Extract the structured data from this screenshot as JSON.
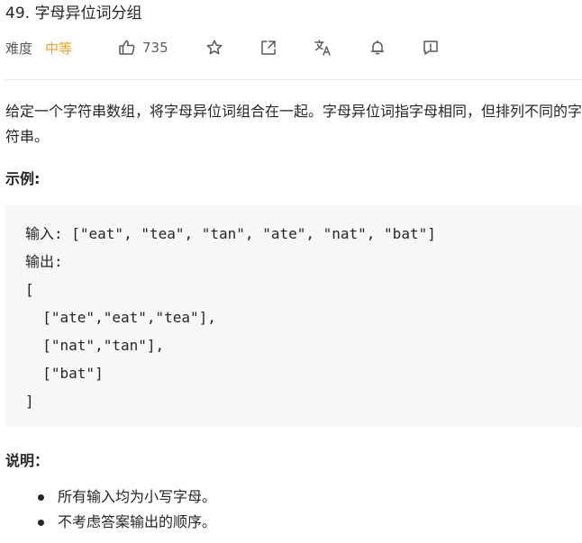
{
  "problem": {
    "title": "49. 字母异位词分组",
    "difficulty_label": "难度",
    "difficulty_value": "中等",
    "likes": "735"
  },
  "toolbar_icons": [
    "thumbs-up-icon",
    "star-icon",
    "share-icon",
    "translate-icon",
    "bell-icon",
    "feedback-icon"
  ],
  "description": "给定一个字符串数组，将字母异位词组合在一起。字母异位词指字母相同，但排列不同的字符串。",
  "example": {
    "heading": "示例:",
    "lines": [
      "输入: [\"eat\", \"tea\", \"tan\", \"ate\", \"nat\", \"bat\"]",
      "输出:",
      "[",
      "  [\"ate\",\"eat\",\"tea\"],",
      "  [\"nat\",\"tan\"],",
      "  [\"bat\"]",
      "]"
    ]
  },
  "notes": {
    "heading": "说明：",
    "items": [
      "所有输入均为小写字母。",
      "不考虑答案输出的顺序。"
    ]
  },
  "colors": {
    "difficulty_medium": "#ffa116",
    "code_background": "#f7f7f8",
    "text": "#262626"
  }
}
